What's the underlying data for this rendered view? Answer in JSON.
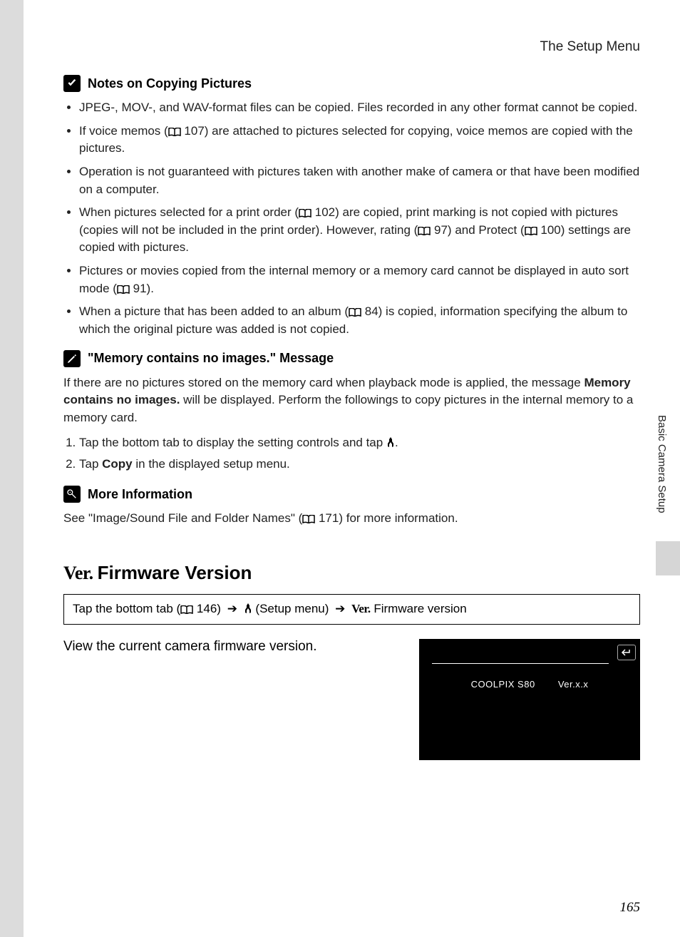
{
  "header": "The Setup Menu",
  "sections": {
    "notes": {
      "title": "Notes on Copying Pictures",
      "bullets": {
        "b0": "JPEG-, MOV-, and WAV-format files can be copied. Files recorded in any other format cannot be copied.",
        "b1a": "If voice memos (",
        "b1b": " 107) are attached to pictures selected for copying, voice memos are copied with the pictures.",
        "b2": "Operation is not guaranteed with pictures taken with another make of camera or that have been modified on a computer.",
        "b3a": "When pictures selected for a print order (",
        "b3b": " 102) are copied, print marking is not copied with pictures (copies will not be included in the print order). However, rating (",
        "b3c": " 97) and Protect (",
        "b3d": " 100) settings are copied with pictures.",
        "b4a": "Pictures or movies copied from the internal memory or a memory card cannot be displayed in auto sort mode (",
        "b4b": " 91).",
        "b5a": "When a picture that has been added to an album (",
        "b5b": " 84) is copied, information specifying the album to which the original picture was added is not copied."
      }
    },
    "memory": {
      "title": "\"Memory contains no images.\" Message",
      "p1a": "If there are no pictures stored on the memory card when playback mode is applied, the message ",
      "p1bold": "Memory contains no images.",
      "p1b": " will be displayed. Perform the followings to copy pictures in the internal memory to a memory card.",
      "step1a": "Tap the bottom tab to display the setting controls and tap ",
      "step1b": ".",
      "step2a": "Tap ",
      "step2bold": "Copy",
      "step2b": " in the displayed setup menu."
    },
    "moreinfo": {
      "title": "More Information",
      "p1a": "See \"Image/Sound File and Folder Names\" (",
      "p1b": " 171) for more information."
    }
  },
  "firmware": {
    "heading": "Firmware Version",
    "path": {
      "a": "Tap the bottom tab (",
      "b": " 146) ",
      "c": " (Setup menu) ",
      "d": " Firmware version"
    },
    "desc": "View the current camera firmware version.",
    "screen": {
      "model": "COOLPIX S80",
      "ver": "Ver.x.x"
    }
  },
  "sidebar": "Basic Camera Setup",
  "pagenum": "165",
  "ver_label": "Ver."
}
